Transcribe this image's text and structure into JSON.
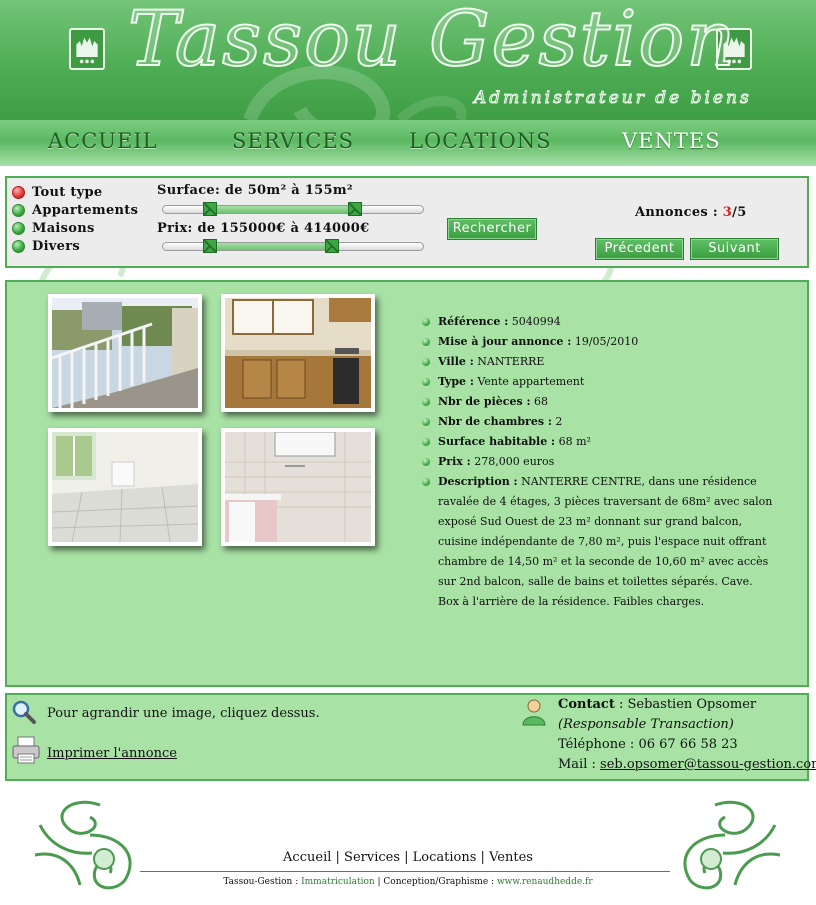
{
  "header": {
    "logo_title": "Tassou Gestion",
    "logo_subtitle": "Administrateur de biens"
  },
  "nav": [
    {
      "label": "ACCUEIL",
      "active": false
    },
    {
      "label": "SERVICES",
      "active": false
    },
    {
      "label": "LOCATIONS",
      "active": false
    },
    {
      "label": "VENTES",
      "active": true
    }
  ],
  "filter": {
    "types": [
      {
        "label": "Tout type",
        "selected": true
      },
      {
        "label": "Appartements",
        "selected": false
      },
      {
        "label": "Maisons",
        "selected": false
      },
      {
        "label": "Divers",
        "selected": false
      }
    ],
    "surface_label": "Surface: de 50m² à 155m²",
    "surface_range_fraction": [
      0.18,
      0.74
    ],
    "price_label": "Prix: de 155000€ à 414000€",
    "price_range_fraction": [
      0.18,
      0.65
    ],
    "search_button": "Rechercher",
    "annonces_label": "Annonces :",
    "annonces_current": "3",
    "annonces_total": "/5",
    "prev_button": "Précedent",
    "next_button": "Suivant"
  },
  "listing": {
    "details": [
      {
        "key": "Référence :",
        "value": " 5040994"
      },
      {
        "key": "Mise à jour annonce :",
        "value": " 19/05/2010"
      },
      {
        "key": "Ville :",
        "value": " NANTERRE"
      },
      {
        "key": "Type :",
        "value": " Vente appartement"
      },
      {
        "key": "Nbr de pièces :",
        "value": " 68"
      },
      {
        "key": "Nbr de chambres :",
        "value": " 2"
      },
      {
        "key": "Surface habitable :",
        "value": " 68 m²"
      },
      {
        "key": "Prix :",
        "value": " 278,000 euros"
      },
      {
        "key": "Description :",
        "value": " NANTERRE CENTRE, dans une résidence ravalée de 4 étages, 3 pièces traversant de 68m² avec salon exposé Sud Ouest de 23 m² donnant sur grand balcon, cuisine indépendante de 7,80 m², puis l'espace nuit offrant chambre de 14,50 m² et la seconde de 10,60 m² avec accès sur 2nd balcon, salle de bains et toilettes séparés. Cave. Box à l'arrière de la résidence. Faibles charges."
      }
    ]
  },
  "info": {
    "enlarge_hint": "Pour agrandir une image, cliquez dessus.",
    "print_link": "Imprimer l'annonce",
    "contact_label": "Contact",
    "contact_name": " : Sebastien Opsomer",
    "contact_role": "(Responsable Transaction)",
    "phone": "Téléphone : 06 67 66 58 23",
    "mail_label": "Mail : ",
    "mail": "seb.opsomer@tassou-gestion.com"
  },
  "footer": {
    "links": [
      "Accueil",
      "Services",
      "Locations",
      "Ventes"
    ],
    "separator": " | ",
    "credit_prefix": "Tassou-Gestion : ",
    "credit_link1": "Immatriculation",
    "credit_mid": " | Conception/Graphisme : ",
    "credit_link2": "www.renaudhedde.fr"
  },
  "colors": {
    "header_green": "#4fae55",
    "panel_green": "#a8e2a5",
    "accent_red": "#d22020"
  },
  "icons": [
    "magnifier-icon",
    "printer-icon",
    "contact-person-icon",
    "crest-icon",
    "radio-dot-icon"
  ]
}
